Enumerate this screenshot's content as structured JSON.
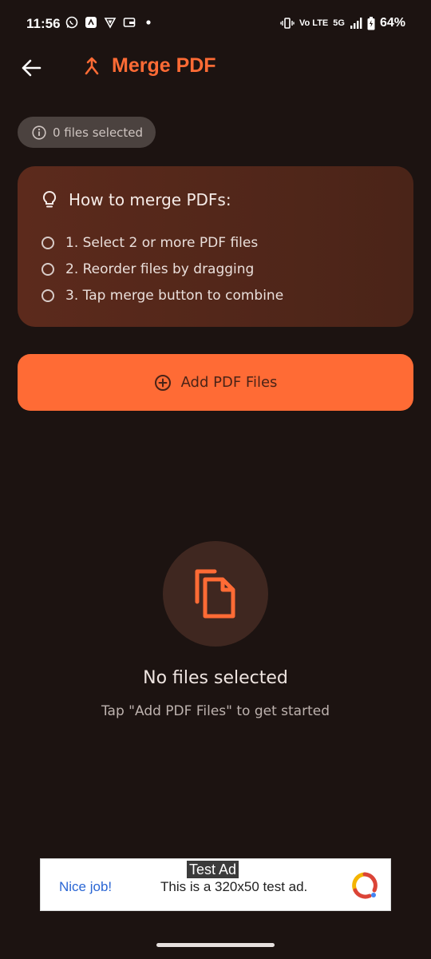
{
  "status_bar": {
    "time": "11:56",
    "volte_label": "Vo LTE",
    "network": "5G",
    "battery": "64%"
  },
  "app_bar": {
    "title": "Merge PDF"
  },
  "chip": {
    "label": "0 files selected"
  },
  "info_card": {
    "title": "How to merge PDFs:",
    "steps": [
      "1. Select 2 or more PDF files",
      "2. Reorder files by dragging",
      "3. Tap merge button to combine"
    ]
  },
  "add_button": {
    "label": "Add PDF Files"
  },
  "empty_state": {
    "title": "No files selected",
    "subtitle": "Tap \"Add PDF Files\" to get started"
  },
  "ad": {
    "tag": "Test Ad",
    "headline": "Nice job!",
    "body": "This is a 320x50 test ad."
  },
  "colors": {
    "accent": "#ff6b35",
    "background": "#1c1311",
    "card": "#5c2a1c"
  },
  "icons": {
    "back": "arrow-left-icon",
    "merge": "merge-icon",
    "info": "info-icon",
    "bulb": "lightbulb-icon",
    "add": "add-circle-icon",
    "files": "files-copy-icon"
  }
}
